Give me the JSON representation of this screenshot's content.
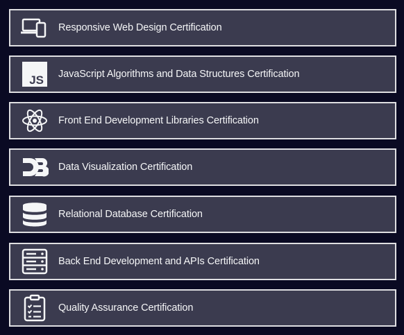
{
  "certifications": [
    {
      "label": "Responsive Web Design Certification",
      "icon": "responsive-devices-icon"
    },
    {
      "label": "JavaScript Algorithms and Data Structures Certification",
      "icon": "javascript-icon",
      "icon_text": "JS"
    },
    {
      "label": "Front End Development Libraries Certification",
      "icon": "react-atom-icon"
    },
    {
      "label": "Data Visualization Certification",
      "icon": "d3-icon"
    },
    {
      "label": "Relational Database Certification",
      "icon": "database-icon"
    },
    {
      "label": "Back End Development and APIs Certification",
      "icon": "server-icon"
    },
    {
      "label": "Quality Assurance Certification",
      "icon": "clipboard-checklist-icon"
    }
  ],
  "colors": {
    "background": "#0a0a23",
    "card": "#3b3b4f",
    "border": "#dfdfe2",
    "text": "#f5f6f7"
  }
}
